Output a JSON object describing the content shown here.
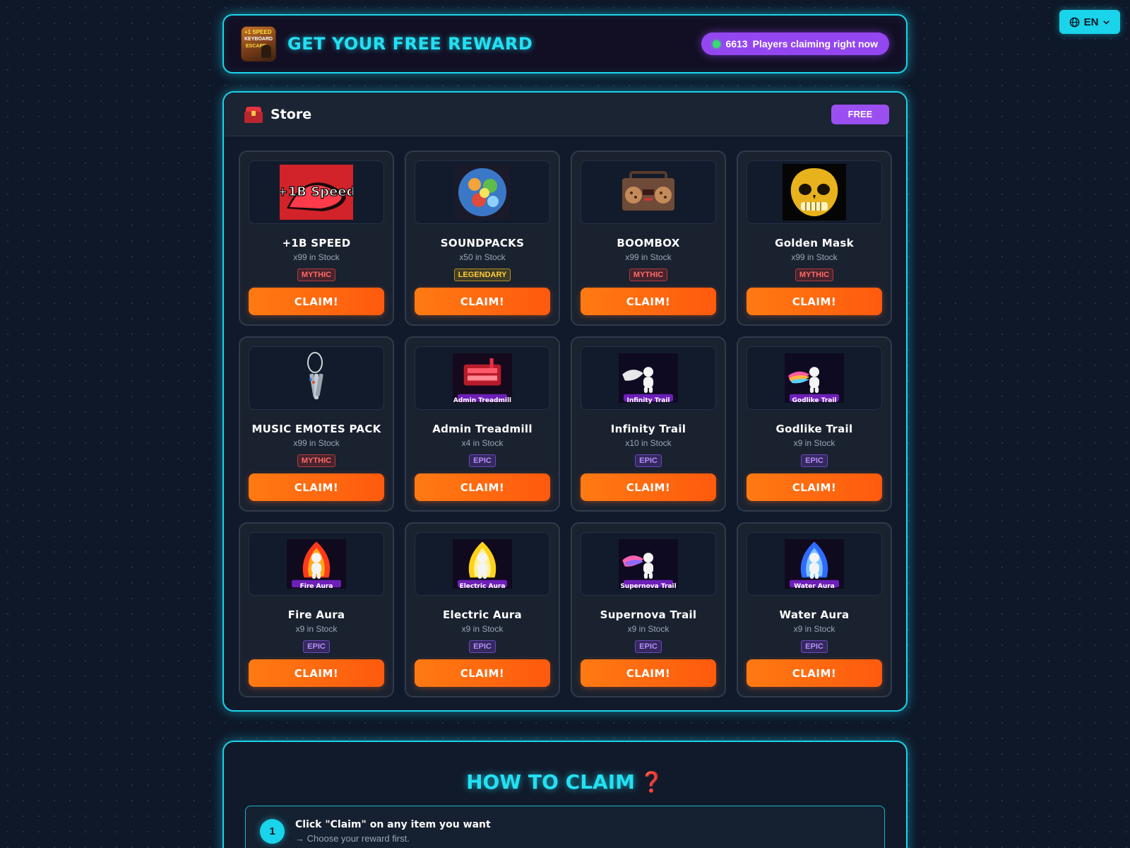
{
  "lang": {
    "label": "EN"
  },
  "header": {
    "logo_text": [
      "+1 SPEED",
      "KEYBOARD",
      "ESCAPE"
    ],
    "title": "GET YOUR FREE REWARD",
    "players_count": "6613",
    "players_text": "Players claiming right now"
  },
  "store": {
    "title": "Store",
    "badge": "FREE"
  },
  "items": [
    {
      "name": "+1B SPEED",
      "stock": "x99 in Stock",
      "rarity": "MYTHIC",
      "claim": "CLAIM!",
      "thumb": "speed",
      "thumb_label": "+1B Speed"
    },
    {
      "name": "SOUNDPACKS",
      "stock": "x50 in Stock",
      "rarity": "LEGENDARY",
      "claim": "CLAIM!",
      "thumb": "sound",
      "thumb_label": ""
    },
    {
      "name": "BOOMBOX",
      "stock": "x99 in Stock",
      "rarity": "MYTHIC",
      "claim": "CLAIM!",
      "thumb": "boombox",
      "thumb_label": ""
    },
    {
      "name": "Golden Mask",
      "stock": "x99 in Stock",
      "rarity": "MYTHIC",
      "claim": "CLAIM!",
      "thumb": "mask",
      "thumb_label": ""
    },
    {
      "name": "MUSIC EMOTES PACK",
      "stock": "x99 in Stock",
      "rarity": "MYTHIC",
      "claim": "CLAIM!",
      "thumb": "keys",
      "thumb_label": ""
    },
    {
      "name": "Admin Treadmill",
      "stock": "x4 in Stock",
      "rarity": "EPIC",
      "claim": "CLAIM!",
      "thumb": "treadmill",
      "thumb_label": "Admin Treadmill"
    },
    {
      "name": "Infinity Trail",
      "stock": "x10 in Stock",
      "rarity": "EPIC",
      "claim": "CLAIM!",
      "thumb": "trail-white",
      "thumb_label": "Infinity Trail"
    },
    {
      "name": "Godlike Trail",
      "stock": "x9 in Stock",
      "rarity": "EPIC",
      "claim": "CLAIM!",
      "thumb": "trail-rainbow",
      "thumb_label": "Godlike Trail"
    },
    {
      "name": "Fire Aura",
      "stock": "x9 in Stock",
      "rarity": "EPIC",
      "claim": "CLAIM!",
      "thumb": "aura-fire",
      "thumb_label": "Fire Aura"
    },
    {
      "name": "Electric Aura",
      "stock": "x9 in Stock",
      "rarity": "EPIC",
      "claim": "CLAIM!",
      "thumb": "aura-electric",
      "thumb_label": "Electric Aura"
    },
    {
      "name": "Supernova Trail",
      "stock": "x9 in Stock",
      "rarity": "EPIC",
      "claim": "CLAIM!",
      "thumb": "trail-nova",
      "thumb_label": "Supernova Trail"
    },
    {
      "name": "Water Aura",
      "stock": "x9 in Stock",
      "rarity": "EPIC",
      "claim": "CLAIM!",
      "thumb": "aura-water",
      "thumb_label": "Water Aura"
    }
  ],
  "howto": {
    "title": "HOW TO CLAIM",
    "icon": "❓",
    "steps": [
      {
        "num": "1",
        "title": "Click \"Claim\" on any item you want",
        "sub": "→ Choose your reward first."
      }
    ]
  },
  "colors": {
    "accent": "#1bd3ea",
    "claim": "#ff6a10",
    "purple": "#9447f0"
  }
}
